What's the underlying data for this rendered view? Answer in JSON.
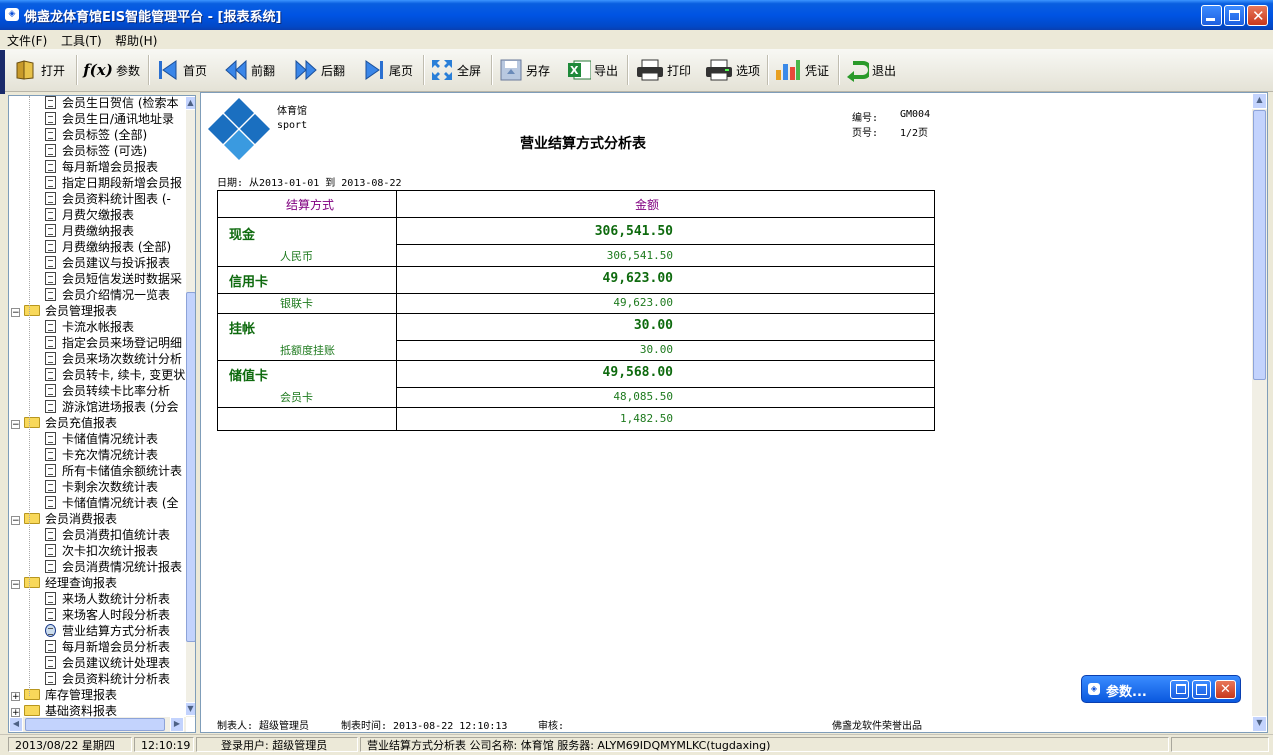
{
  "window": {
    "title": "佛盏龙体育馆EIS智能管理平台 - [报表系统]"
  },
  "menu": [
    {
      "label": "文件(F)"
    },
    {
      "label": "工具(T)"
    },
    {
      "label": "帮助(H)"
    }
  ],
  "toolbar": [
    {
      "label": "打开",
      "icon": "folder-open-icon"
    },
    {
      "label": "参数",
      "icon": "function-icon",
      "glyph": "f(x)"
    },
    {
      "label": "首页",
      "icon": "first-page-icon"
    },
    {
      "label": "前翻",
      "icon": "previous-page-icon"
    },
    {
      "label": "后翻",
      "icon": "next-page-icon"
    },
    {
      "label": "尾页",
      "icon": "last-page-icon"
    },
    {
      "label": "全屏",
      "icon": "fullscreen-icon"
    },
    {
      "label": "另存",
      "icon": "save-as-icon"
    },
    {
      "label": "导出",
      "icon": "excel-export-icon"
    },
    {
      "label": "打印",
      "icon": "printer-icon"
    },
    {
      "label": "选项",
      "icon": "print-options-icon"
    },
    {
      "label": "凭证",
      "icon": "voucher-icon"
    },
    {
      "label": "退出",
      "icon": "exit-icon"
    }
  ],
  "tree": [
    {
      "label": "会员生日贺信 (检索本"
    },
    {
      "label": "会员生日/通讯地址录"
    },
    {
      "label": "会员标签 (全部)"
    },
    {
      "label": "会员标签 (可选)"
    },
    {
      "label": "每月新增会员报表"
    },
    {
      "label": "指定日期段新增会员报"
    },
    {
      "label": "会员资料统计图表 (-"
    },
    {
      "label": "月费欠缴报表"
    },
    {
      "label": "月费缴纳报表"
    },
    {
      "label": "月费缴纳报表 (全部)"
    },
    {
      "label": "会员建议与投诉报表"
    },
    {
      "label": "会员短信发送时数据采"
    },
    {
      "label": "会员介绍情况一览表"
    },
    {
      "label": "会员管理报表",
      "folder": true
    },
    {
      "label": "卡流水帐报表"
    },
    {
      "label": "指定会员来场登记明细"
    },
    {
      "label": "会员来场次数统计分析"
    },
    {
      "label": "会员转卡, 续卡, 变更状"
    },
    {
      "label": "会员转续卡比率分析"
    },
    {
      "label": "游泳馆进场报表 (分会"
    },
    {
      "label": "会员充值报表",
      "folder": true
    },
    {
      "label": "卡储值情况统计表"
    },
    {
      "label": "卡充次情况统计表"
    },
    {
      "label": "所有卡储值余额统计表"
    },
    {
      "label": "卡剩余次数统计表"
    },
    {
      "label": "卡储值情况统计表 (全"
    },
    {
      "label": "会员消费报表",
      "folder": true
    },
    {
      "label": "会员消费扣值统计表"
    },
    {
      "label": "次卡扣次统计报表"
    },
    {
      "label": "会员消费情况统计报表"
    },
    {
      "label": "经理查询报表",
      "folder": true
    },
    {
      "label": "来场人数统计分析表"
    },
    {
      "label": "来场客人时段分析表"
    },
    {
      "label": "营业结算方式分析表",
      "selected": true
    },
    {
      "label": "每月新增会员分析表"
    },
    {
      "label": "会员建议统计处理表"
    },
    {
      "label": "会员资料统计分析表"
    },
    {
      "label": "库存管理报表",
      "folder": true,
      "collapsed": true
    },
    {
      "label": "基础资料报表",
      "folder": true,
      "collapsed": true
    }
  ],
  "report": {
    "logo_text1": "体育馆",
    "logo_text2": "sport",
    "title": "营业结算方式分析表",
    "code_label": "编号:",
    "code_value": "GM004",
    "page_label": "页号:",
    "page_value": "1/2页",
    "date_range": "日期: 从2013-01-01 到 2013-08-22",
    "col_method": "结算方式",
    "col_amount": "金额",
    "groups": [
      {
        "name": "现金",
        "total": "306,541.50",
        "sub_name": "人民币",
        "sub_amount": "306,541.50"
      },
      {
        "name": "信用卡",
        "total": "49,623.00",
        "sub_name": "银联卡",
        "sub_amount": "49,623.00"
      },
      {
        "name": "挂帐",
        "total": "30.00",
        "sub_name": "抵额度挂账",
        "sub_amount": "30.00"
      },
      {
        "name": "储值卡",
        "total": "49,568.00",
        "sub_name": "会员卡",
        "sub_amount": "48,085.50"
      }
    ],
    "extra_amount": "1,482.50",
    "footer_maker": "制表人: 超级管理员",
    "footer_time": "制表时间: 2013-08-22 12:10:13",
    "footer_audit": "审核:",
    "footer_brand": "佛盏龙软件荣誉出品"
  },
  "param_window": {
    "title": "参数..."
  },
  "status": {
    "date": "2013/08/22 星期四",
    "time": "12:10:19",
    "user": "登录用户: 超级管理员",
    "info": "营业结算方式分析表 公司名称: 体育馆 服务器: ALYM69IDQMYMLKC(tugdaxing)"
  },
  "colors": {
    "title_bar": "#0054e3",
    "report_green": "#1e7a1e",
    "header_purple": "#800080",
    "logo_blue": "#1a6fc0"
  }
}
